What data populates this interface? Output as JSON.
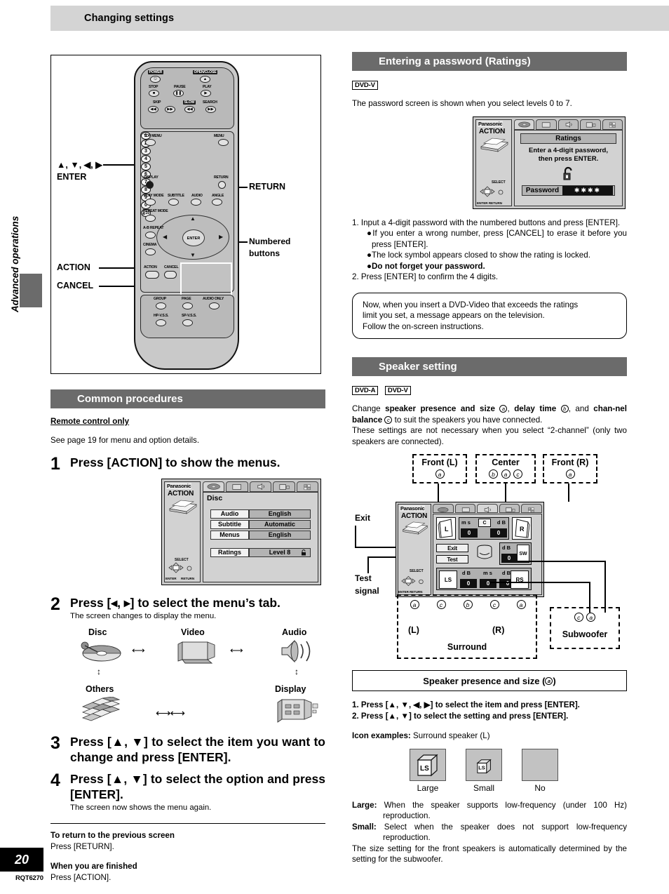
{
  "page": {
    "header_title": "Changing settings",
    "side_tab": "Advanced operations",
    "page_number": "20",
    "doc_code": "RQT6270"
  },
  "remote": {
    "callouts": {
      "arrows": "▲, ▼, ◀, ▶",
      "enter": "ENTER",
      "return": "RETURN",
      "numbered": "Numbered",
      "numbered2": "buttons",
      "action": "ACTION",
      "cancel": "CANCEL"
    },
    "labels": {
      "power": "POWER",
      "open_close": "OPEN/CLOSE",
      "stop": "STOP",
      "pause": "PAUSE",
      "play": "PLAY",
      "skip": "SKIP",
      "slow": "SLOW",
      "search": "SEARCH",
      "top_menu": "TOP MENU",
      "menu": "MENU",
      "display": "DISPLAY",
      "return": "RETURN",
      "enter": "ENTER",
      "play_mode": "PLAY MODE",
      "subtitle": "SUBTITLE",
      "audio": "AUDIO",
      "angle": "ANGLE",
      "repeat_mode": "REPEAT MODE",
      "ab_repeat": "A-B REPEAT",
      "cinema": "CINEMA",
      "action": "ACTION",
      "cancel": "CANCEL",
      "group": "GROUP",
      "page": "PAGE",
      "audio_only": "AUDIO ONLY",
      "hp_vss": "HP-V.S.S.",
      "sp_vss": "SP-V.S.S.",
      "num_1": "1",
      "num_2": "2",
      "num_3": "3",
      "num_4": "4",
      "num_5": "5",
      "num_6": "6",
      "num_7": "7",
      "num_8": "8",
      "num_9": "9",
      "num_0": "0",
      "num_10": "≧10"
    }
  },
  "common_procedures": {
    "heading": "Common procedures",
    "subheading": "Remote control only",
    "intro": "See page 19 for menu and option details.",
    "steps": [
      {
        "no": "1",
        "text": "Press [ACTION] to show the menus.",
        "sub": ""
      },
      {
        "no": "2",
        "text": "Press [◂, ▸] to select the menu’s tab.",
        "sub": "The screen changes to display the menu."
      },
      {
        "no": "3",
        "text": "Press [▲, ▼] to select the item you want to change and press [ENTER].",
        "sub": ""
      },
      {
        "no": "4",
        "text": "Press [▲, ▼] to select the option and press [ENTER].",
        "sub": "The screen now shows the menu again."
      }
    ],
    "disc_menu": {
      "brand": "Panasonic",
      "action": "ACTION",
      "select": "SELECT",
      "enter": "ENTER",
      "return": "RETURN",
      "tab_title": "Disc",
      "rows": [
        {
          "key": "Audio",
          "value": "English"
        },
        {
          "key": "Subtitle",
          "value": "Automatic"
        },
        {
          "key": "Menus",
          "value": "English"
        }
      ],
      "ratings_row": {
        "key": "Ratings",
        "value": "Level 8"
      }
    },
    "tab_flow": {
      "disc": "Disc",
      "video": "Video",
      "audio": "Audio",
      "others": "Others",
      "display": "Display"
    },
    "footer": {
      "return_title": "To return to the previous screen",
      "return_text": "Press [RETURN].",
      "finish_title": "When you are finished",
      "finish_text": "Press [ACTION]."
    }
  },
  "password": {
    "heading": "Entering a password (Ratings)",
    "badge": "DVD-V",
    "intro": "The password screen is shown when you select levels 0 to 7.",
    "osd": {
      "brand": "Panasonic",
      "action": "ACTION",
      "select": "SELECT",
      "enter_return": "ENTER RETURN",
      "title": "Ratings",
      "line1": "Enter a 4-digit password,",
      "line2": "then press ENTER.",
      "password_label": "Password",
      "password_value": "✱✱✱✱"
    },
    "steps": [
      "1.  Input a 4-digit password with the numbered buttons and press [ENTER].",
      "2.  Press [ENTER] to confirm the 4 digits."
    ],
    "bullets": [
      "If you enter a wrong number, press [CANCEL] to erase it before you press [ENTER].",
      "The lock symbol appears closed to show the rating is locked.",
      "Do not forget your password."
    ],
    "note": [
      "Now, when you insert a DVD-Video that exceeds the ratings",
      "limit you set, a message appears on the television.",
      "Follow the on-screen instructions."
    ]
  },
  "speaker": {
    "heading": "Speaker setting",
    "badges": [
      "DVD-A",
      "DVD-V"
    ],
    "intro_parts": {
      "p1": "Change ",
      "b1": "speaker presence and size",
      "a": "a",
      "p2": ", ",
      "b2": "delay time",
      "b": "b",
      "p3": ", and ",
      "b3": "chan-",
      "b3b": "nel balance",
      "c": "c",
      "p4": " to suit the speakers you have connected.",
      "p5": "These settings are not necessary when you select “2-channel” (only two speakers are connected)."
    },
    "diagram": {
      "front_l": "Front (L)",
      "center": "Center",
      "front_r": "Front (R)",
      "exit_callout": "Exit",
      "test_callout_1": "Test",
      "test_callout_2": "signal",
      "surround_l": "(L)",
      "surround_r": "(R)",
      "surround": "Surround",
      "subwoofer": "Subwoofer",
      "osd": {
        "brand": "Panasonic",
        "action": "ACTION",
        "select": "SELECT",
        "enter_return": "ENTER RETURN",
        "exit_btn": "Exit",
        "test_btn": "Test",
        "l": "L",
        "r": "R",
        "c": "C",
        "ls": "LS",
        "rs": "RS",
        "sw": "SW",
        "ms": "m s",
        "db": "d B",
        "v_ms_center": "0",
        "v_db_center": "0",
        "v_db_sw": "0",
        "v_db_ls": "0",
        "v_ms_sur": "0",
        "v_db_rs": "0"
      }
    },
    "presence": {
      "title": "Speaker presence and size (",
      "title_mark": "a",
      "title_end": ")",
      "steps": [
        "1.  Press [▲, ▼, ◀, ▶] to select the item and press [ENTER].",
        "2.  Press [▲, ▼] to select the setting and press [ENTER]."
      ],
      "icon_examples_label": "Icon examples:",
      "icon_examples_value": "Surround speaker (L)",
      "icons": [
        {
          "label": "LS",
          "cap": "Large"
        },
        {
          "label": "LS",
          "cap": "Small"
        },
        {
          "label": "",
          "cap": "No"
        }
      ],
      "defs": [
        {
          "term": "Large:",
          "text": "When the speaker supports low-frequency (under 100 Hz) reproduction."
        },
        {
          "term": "Small:",
          "text": "Select when the speaker does not support low-frequency reproduction."
        }
      ],
      "tail": "The size setting for the front speakers is automatically determined by the setting for the subwoofer."
    }
  }
}
